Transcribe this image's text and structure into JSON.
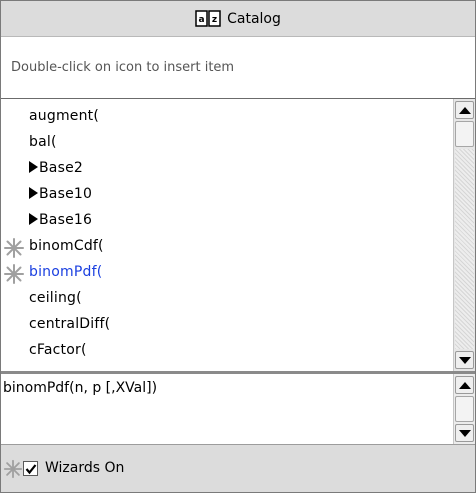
{
  "title": "Catalog",
  "hint": "Double-click on icon to insert item",
  "items": [
    {
      "label": "augment(",
      "wizard": false,
      "folder": false,
      "selected": false
    },
    {
      "label": "bal(",
      "wizard": false,
      "folder": false,
      "selected": false
    },
    {
      "label": "Base2",
      "wizard": false,
      "folder": true,
      "selected": false
    },
    {
      "label": "Base10",
      "wizard": false,
      "folder": true,
      "selected": false
    },
    {
      "label": "Base16",
      "wizard": false,
      "folder": true,
      "selected": false
    },
    {
      "label": "binomCdf(",
      "wizard": true,
      "folder": false,
      "selected": false
    },
    {
      "label": "binomPdf(",
      "wizard": true,
      "folder": false,
      "selected": true
    },
    {
      "label": "ceiling(",
      "wizard": false,
      "folder": false,
      "selected": false
    },
    {
      "label": "centralDiff(",
      "wizard": false,
      "folder": false,
      "selected": false
    },
    {
      "label": "cFactor(",
      "wizard": false,
      "folder": false,
      "selected": false
    }
  ],
  "syntax": "binomPdf(n, p [,XVal])",
  "footer": {
    "checkbox_label": "Wizards On",
    "checked": true
  },
  "icons": {
    "title": "catalog-book-icon",
    "wizard": "wizard-star-icon"
  },
  "colors": {
    "selected_text": "#1a3fe0",
    "header_bg": "#dcdcdc"
  }
}
